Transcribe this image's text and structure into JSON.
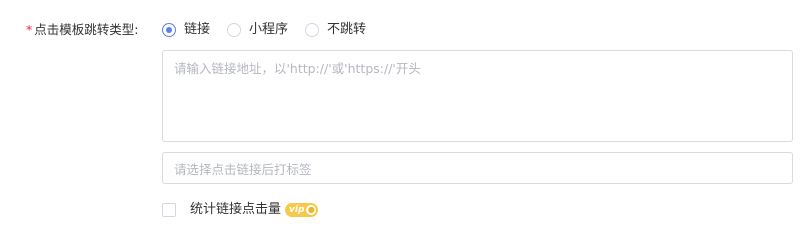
{
  "jump_type": {
    "label": "点击模板跳转类型:",
    "required_mark": "*",
    "options": [
      {
        "label": "链接",
        "checked": true
      },
      {
        "label": "小程序",
        "checked": false
      },
      {
        "label": "不跳转",
        "checked": false
      }
    ]
  },
  "link_input": {
    "placeholder": "请输入链接地址，以'http://'或'https://'开头",
    "value": ""
  },
  "tag_select": {
    "placeholder": "请选择点击链接后打标签"
  },
  "stats_checkbox": {
    "label": "统计链接点击量",
    "checked": false,
    "badge": {
      "text": "vip",
      "icon": "lock-icon",
      "color": "#f7c94a"
    }
  },
  "colors": {
    "accent": "#5d80e9",
    "required": "#f5222d",
    "placeholder": "#b5b8c0",
    "border": "#d9dbe1"
  }
}
